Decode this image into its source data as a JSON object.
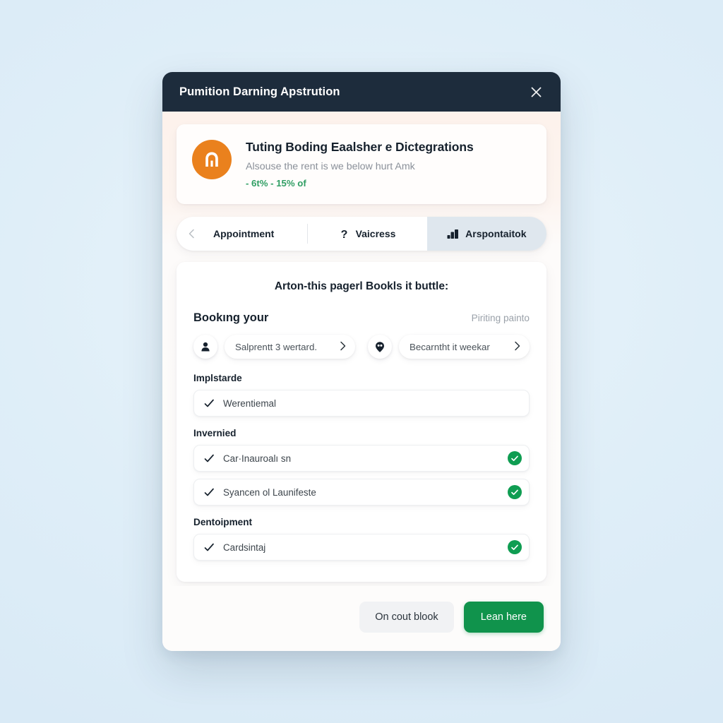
{
  "window": {
    "title": "Pumition Darning Apstrution",
    "close_icon": "close-icon"
  },
  "banner": {
    "icon": "arch-monument-icon",
    "icon_color": "#ea811d",
    "title": "Tuting Boding Eaalsher e Dictegrations",
    "subtitle": "Alsouse the rent is we below hurt Amk",
    "accent": "- 6t% - 15% of",
    "accent_color": "#2f9e63"
  },
  "tabs": [
    {
      "label": "Appointment",
      "icon": "chevron-left-icon",
      "active": false
    },
    {
      "label": "Vaicress",
      "icon": "question-mark-icon",
      "active": false
    },
    {
      "label": "Arspontaitok",
      "icon": "bar-chart-icon",
      "active": true
    }
  ],
  "panel": {
    "heading": "Arton-this pagerl Bookls it buttle:",
    "section_title": "Bookıng your",
    "section_aside": "Piriting painto",
    "selectors": [
      {
        "icon": "person-icon",
        "label": "Salprentt 3 wertard.",
        "chevron": "chevron-right-icon"
      },
      {
        "icon": "location-pin-icon",
        "label": "Becarntht it weekar",
        "chevron": "chevron-right-icon"
      }
    ],
    "groups": [
      {
        "label": "Implstarde",
        "rows": [
          {
            "icon": "check-icon",
            "text": "Werentiemal",
            "status": false
          }
        ]
      },
      {
        "label": "Invernied",
        "rows": [
          {
            "icon": "check-icon",
            "text": "Car·Inauroalı sn",
            "status": true
          },
          {
            "icon": "check-icon",
            "text": "Syancen ol Launifeste",
            "status": true
          }
        ]
      },
      {
        "label": "Dentoipment",
        "rows": [
          {
            "icon": "check-icon",
            "text": "Cardsintaj",
            "status": true
          }
        ]
      }
    ]
  },
  "footer": {
    "secondary_label": "On cout blook",
    "primary_label": "Lean here",
    "primary_color": "#10934c"
  }
}
